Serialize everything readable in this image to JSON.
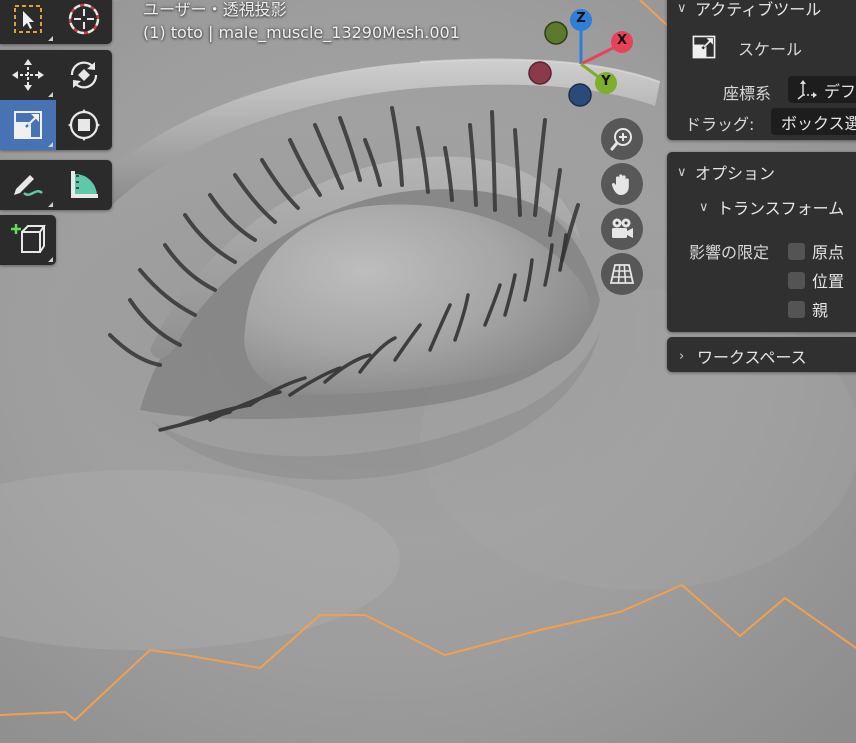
{
  "viewport": {
    "view_name": "ユーザー・透視投影",
    "object_name": "(1) toto | male_muscle_13290Mesh.001"
  },
  "gizmo": {
    "axis_z": "Z",
    "axis_x": "X",
    "axis_y": "Y",
    "color_x": "#e8425a",
    "color_y": "#7fae2a",
    "color_z": "#2f7ed8"
  },
  "toolbar": {
    "active_tool": "scale",
    "tools": [
      "select-box",
      "cursor",
      "move",
      "rotate",
      "scale",
      "transform",
      "annotate",
      "measure",
      "add-cube"
    ]
  },
  "navigation": [
    "zoom-icon",
    "hand-icon",
    "camera-icon",
    "grid-icon"
  ],
  "sidebar": {
    "active_tool_panel": {
      "header": "アクティブツール",
      "tool_name": "スケール",
      "orientation_label": "座標系",
      "orientation_value": "デフ",
      "drag_label": "ドラッグ:",
      "drag_value": "ボックス選"
    },
    "options_panel": {
      "header": "オプション",
      "transform_header": "トランスフォーム",
      "affect_only_label": "影響の限定",
      "checkboxes": [
        {
          "label": "原点",
          "checked": false
        },
        {
          "label": "位置",
          "checked": false
        },
        {
          "label": "親",
          "checked": false
        }
      ]
    },
    "workspace_panel": {
      "header": "ワークスペース"
    }
  },
  "colors": {
    "accent": "#4772b3",
    "selection_outline": "#f0a050",
    "panel_bg": "#303030",
    "mesh": "#a8a8a8"
  }
}
